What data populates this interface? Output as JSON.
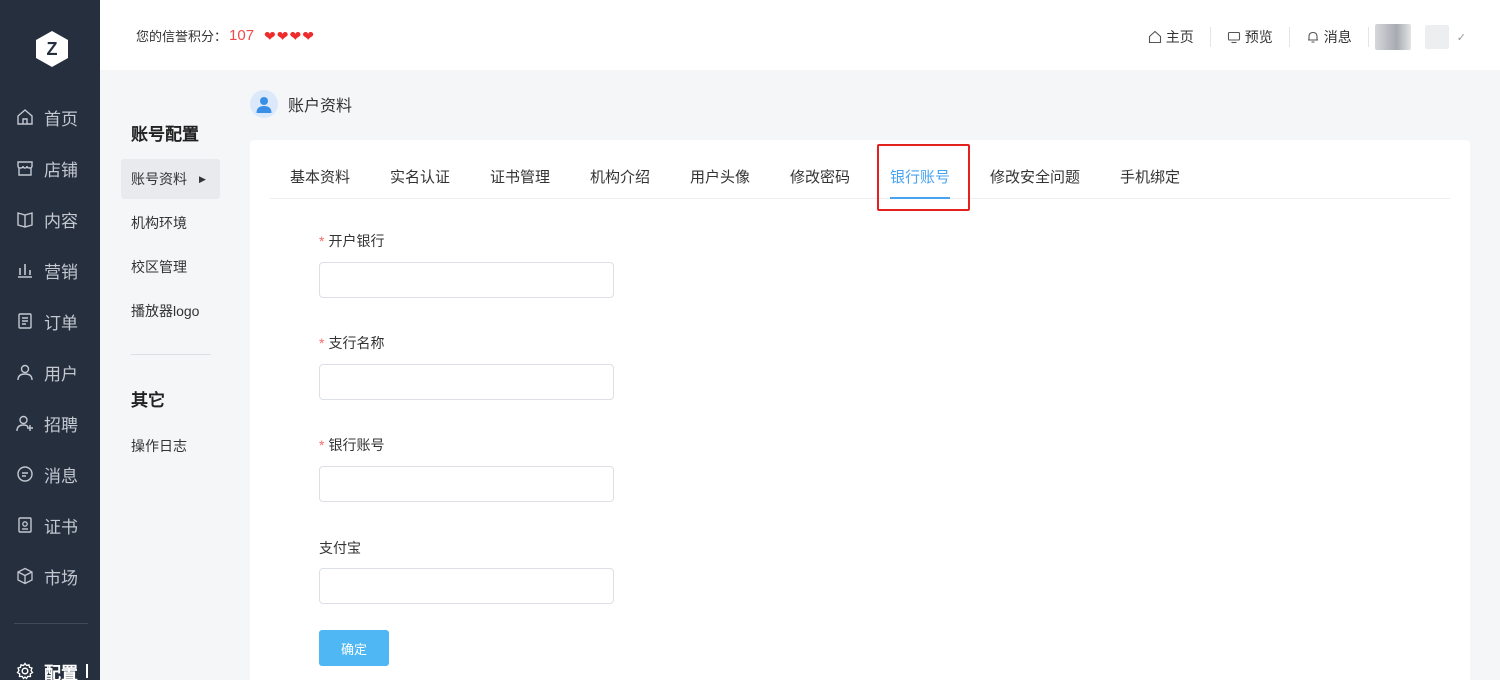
{
  "nav": {
    "logo_letter": "Z",
    "items": [
      {
        "label": "首页",
        "icon": "home-icon"
      },
      {
        "label": "店铺",
        "icon": "store-icon"
      },
      {
        "label": "内容",
        "icon": "book-icon"
      },
      {
        "label": "营销",
        "icon": "chart-icon"
      },
      {
        "label": "订单",
        "icon": "order-icon"
      },
      {
        "label": "用户",
        "icon": "user-icon"
      },
      {
        "label": "招聘",
        "icon": "user-add-icon"
      },
      {
        "label": "消息",
        "icon": "message-icon"
      },
      {
        "label": "证书",
        "icon": "certificate-icon"
      },
      {
        "label": "市场",
        "icon": "cube-icon"
      }
    ],
    "active_item": {
      "label": "配置",
      "icon": "gear-icon"
    }
  },
  "header": {
    "credit_label": "您的信誉积分：",
    "credit_score": "107",
    "hearts": 4,
    "links": [
      {
        "label": "主页",
        "icon": "home-icon"
      },
      {
        "label": "预览",
        "icon": "monitor-icon"
      },
      {
        "label": "消息",
        "icon": "bell-icon"
      }
    ]
  },
  "subnav": {
    "section1_title": "账号配置",
    "section1_items": [
      "账号资料",
      "机构环境",
      "校区管理",
      "播放器logo"
    ],
    "active_index": 0,
    "section2_title": "其它",
    "section2_items": [
      "操作日志"
    ]
  },
  "page": {
    "title": "账户资料"
  },
  "tabs": [
    "基本资料",
    "实名认证",
    "证书管理",
    "机构介绍",
    "用户头像",
    "修改密码",
    "银行账号",
    "修改安全问题",
    "手机绑定"
  ],
  "active_tab": 6,
  "form": {
    "fields": [
      {
        "label": "开户银行",
        "required": true,
        "value": "",
        "placeholder": ""
      },
      {
        "label": "支行名称",
        "required": true,
        "value": "",
        "placeholder": ""
      },
      {
        "label": "银行账号",
        "required": true,
        "value": "",
        "placeholder": ""
      },
      {
        "label": "支付宝",
        "required": false,
        "value": "",
        "placeholder": ""
      }
    ],
    "submit_label": "确定"
  },
  "colors": {
    "nav_bg": "#262f3e",
    "accent": "#4aa3ef",
    "button": "#4fb8f4",
    "score": "#f04b4b",
    "highlight": "#e3211f"
  }
}
